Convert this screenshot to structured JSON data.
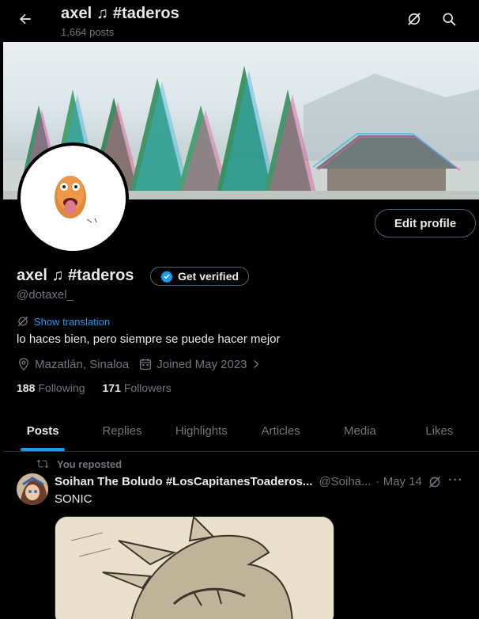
{
  "header": {
    "title": "axel ♫ #taderos",
    "post_count": "1,664 posts"
  },
  "profile": {
    "display_name": "axel ♫ #taderos",
    "handle": "@dotaxel_",
    "get_verified_label": "Get verified",
    "edit_profile_label": "Edit profile",
    "show_translation_label": "Show translation",
    "bio": "lo haces bien, pero siempre se puede hacer mejor",
    "location": "Mazatlán, Sinaloa",
    "joined": "Joined May 2023",
    "following_count": "188",
    "following_label": "Following",
    "followers_count": "171",
    "followers_label": "Followers"
  },
  "tabs": [
    {
      "label": "Posts",
      "active": true
    },
    {
      "label": "Replies",
      "active": false
    },
    {
      "label": "Highlights",
      "active": false
    },
    {
      "label": "Articles",
      "active": false
    },
    {
      "label": "Media",
      "active": false
    },
    {
      "label": "Likes",
      "active": false
    }
  ],
  "post": {
    "repost_label": "You reposted",
    "author_name": "Soihan The Boludo #LosCapitanesToaderos...",
    "author_handle": "@Soiha...",
    "date": "· May 14",
    "more_label": "···",
    "text": "SONIC"
  },
  "icons": {
    "back": "arrow-left-icon",
    "grok": "grok-icon",
    "search": "search-icon",
    "verified": "verified-badge-icon",
    "translate": "translate-icon",
    "location": "location-pin-icon",
    "calendar": "calendar-icon",
    "chevron": "chevron-right-icon",
    "repost": "repost-icon"
  },
  "colors": {
    "background": "#000000",
    "text_primary": "#e7e9ea",
    "text_secondary": "#71767b",
    "accent": "#1d9bf0",
    "border": "#2f3336"
  }
}
